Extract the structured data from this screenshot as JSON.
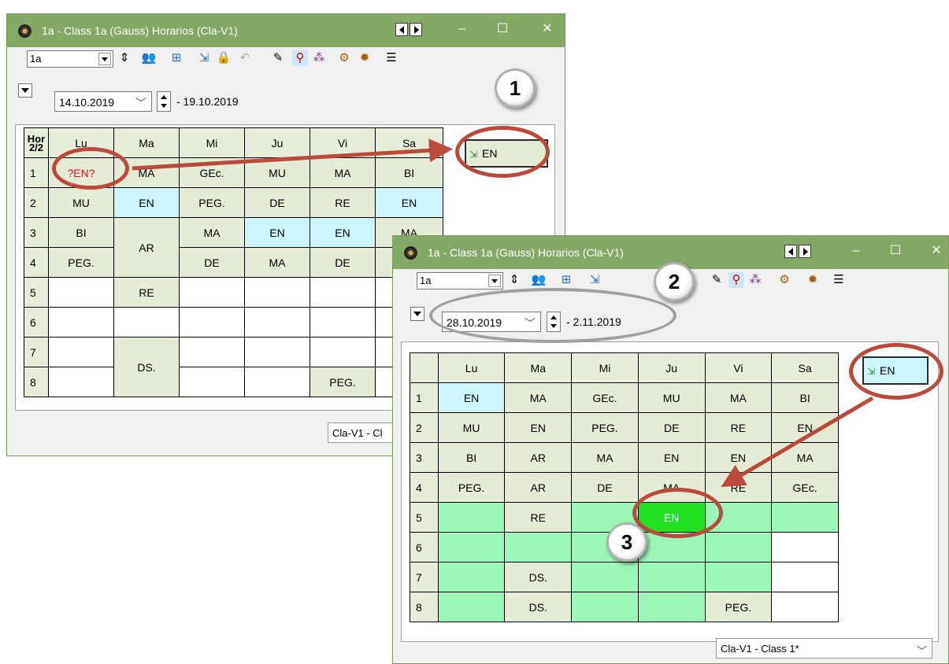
{
  "back_window": {
    "title": "1a - Class 1a (Gauss)  Horarios  (Cla-V1)",
    "class_value": "1a",
    "date_start": "14.10.2019",
    "date_end": "- 19.10.2019",
    "corner_label": "Hor\n2/2",
    "days": [
      "Lu",
      "Ma",
      "Mi",
      "Ju",
      "Vi",
      "Sa"
    ],
    "hours": [
      "1",
      "2",
      "3",
      "4",
      "5",
      "6",
      "7",
      "8"
    ],
    "rows": [
      [
        "?EN?",
        "MA",
        "GEc.",
        "MU",
        "MA",
        "BI"
      ],
      [
        "MU",
        "EN",
        "PEG.",
        "DE",
        "RE",
        "EN"
      ],
      [
        "BI",
        "AR",
        "MA",
        "EN",
        "EN",
        "MA"
      ],
      [
        "PEG.",
        "",
        "DE",
        "MA",
        "DE",
        ""
      ],
      [
        "",
        "RE",
        "",
        "",
        "",
        ""
      ],
      [
        "",
        "",
        "",
        "",
        "",
        ""
      ],
      [
        "",
        "DS.",
        "",
        "",
        "",
        ""
      ],
      [
        "",
        "",
        "",
        "",
        "PEG.",
        ""
      ]
    ],
    "drag_card_label": "EN",
    "status_text": "Cla-V1 - Cl"
  },
  "front_window": {
    "title": "1a - Class 1a (Gauss)  Horarios  (Cla-V1)",
    "class_value": "1a",
    "date_start": "28.10.2019",
    "date_end": "- 2.11.2019",
    "days": [
      "Lu",
      "Ma",
      "Mi",
      "Ju",
      "Vi",
      "Sa"
    ],
    "hours": [
      "1",
      "2",
      "3",
      "4",
      "5",
      "6",
      "7",
      "8"
    ],
    "rows": [
      [
        "EN",
        "MA",
        "GEc.",
        "MU",
        "MA",
        "BI"
      ],
      [
        "MU",
        "EN",
        "PEG.",
        "DE",
        "RE",
        "EN"
      ],
      [
        "BI",
        "AR",
        "MA",
        "EN",
        "EN",
        "MA"
      ],
      [
        "PEG.",
        "AR",
        "DE",
        "MA",
        "RE",
        "GEc."
      ],
      [
        "",
        "RE",
        "",
        "EN",
        "",
        ""
      ],
      [
        "",
        "",
        "",
        "",
        "",
        ""
      ],
      [
        "",
        "DS.",
        "",
        "",
        "",
        ""
      ],
      [
        "",
        "DS.",
        "",
        "",
        "PEG.",
        ""
      ]
    ],
    "drag_card_label": "EN",
    "status_text": "Cla-V1 - Class 1*"
  },
  "callouts": {
    "one": "1",
    "two": "2",
    "three": "3"
  },
  "colors": {
    "titlebar": "#84a866",
    "occupied_cell": "#e4ecd5",
    "highlight_cell": "#cdf6ff",
    "free_slot": "#9bf7b8",
    "drop_target": "#22e022",
    "annotation": "#b94a3c",
    "conflict_text": "#e0102a"
  },
  "icons": [
    "clock-icon",
    "prev-arrow-icon",
    "next-arrow-icon",
    "minimize-icon",
    "maximize-icon",
    "close-icon",
    "spin-icon",
    "people-icon",
    "grid-icon",
    "import-icon",
    "lock-icon",
    "undo-icon",
    "palette-icon",
    "search-icon",
    "molecule-icon",
    "settings-icon",
    "gear-icon",
    "list-icon"
  ]
}
